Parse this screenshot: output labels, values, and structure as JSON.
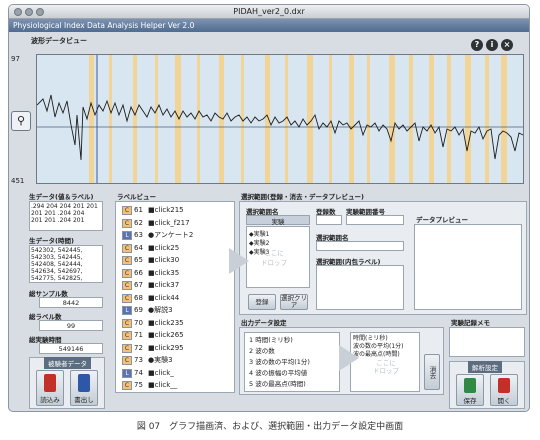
{
  "window": {
    "title": "PIDAH_ver2_0.dxr"
  },
  "app": {
    "title": "Physiological Index Data Analysis Helper Ver 2.0"
  },
  "wave_section": {
    "label": "波形データビュー",
    "y_top": "97",
    "y_bottom": "451"
  },
  "raw_data_label_section": {
    "label": "生データ(値＆ラベル)",
    "rows": [
      ".294 204 204 201 201",
      "201 201 .204 204",
      "201 201 .204 201"
    ]
  },
  "raw_data_time_section": {
    "label": "生データ(時間)",
    "rows": [
      "542302, 542445,",
      "542303, 542445,",
      "542408, 542444,",
      "542634, 542697,",
      "542775, 542825,"
    ]
  },
  "total_samples": {
    "label": "総サンプル数",
    "value": "8442"
  },
  "total_labels": {
    "label": "総ラベル数",
    "value": "99"
  },
  "total_time": {
    "label": "総実験時間",
    "value": "549146"
  },
  "measurement_data": {
    "label": "被験者データ",
    "load_label": "読込み",
    "save_label": "書出し"
  },
  "label_view": {
    "label": "ラベルビュー",
    "items": [
      {
        "badge": "C",
        "number": "61",
        "name": "■click215",
        "color": "#f4c078"
      },
      {
        "badge": "C",
        "number": "62",
        "name": "■click_f217",
        "color": "#f4c078"
      },
      {
        "badge": "L",
        "number": "63",
        "name": "●アンケート2",
        "color": "#5b73b0"
      },
      {
        "badge": "C",
        "number": "64",
        "name": "■click25",
        "color": "#f4c078"
      },
      {
        "badge": "C",
        "number": "65",
        "name": "■click30",
        "color": "#f4c078"
      },
      {
        "badge": "C",
        "number": "66",
        "name": "■click35",
        "color": "#f4c078"
      },
      {
        "badge": "C",
        "number": "67",
        "name": "■click37",
        "color": "#f4c078"
      },
      {
        "badge": "C",
        "number": "68",
        "name": "■click44",
        "color": "#f4c078"
      },
      {
        "badge": "L",
        "number": "69",
        "name": "●解説3",
        "color": "#5b73b0"
      },
      {
        "badge": "C",
        "number": "70",
        "name": "■click235",
        "color": "#f4c078"
      },
      {
        "badge": "C",
        "number": "71",
        "name": "■click265",
        "color": "#f4c078"
      },
      {
        "badge": "C",
        "number": "72",
        "name": "■click295",
        "color": "#f4c078"
      },
      {
        "badge": "C",
        "number": "73",
        "name": "●実験3",
        "color": "#f4c078"
      },
      {
        "badge": "L",
        "number": "74",
        "name": "■click_",
        "color": "#5b73b0"
      },
      {
        "badge": "C",
        "number": "75",
        "name": "■click__",
        "color": "#f4c078"
      }
    ]
  },
  "selection": {
    "label": "選択範囲(登録・消去・データプレビュー)",
    "range_name_label": "選択範囲名",
    "range_name_tab": "実験",
    "range_list": [
      "◆実験1",
      "◆実験2",
      "◆実験3"
    ],
    "drop_hint_1": "ここに",
    "drop_hint_2": "ドロップ",
    "register_count_label": "登録数",
    "range_number_label": "実験範囲番号",
    "preview_label": "データプレビュー",
    "range_label": "選択範囲名",
    "range_content_label": "選択範囲(内包ラベル)",
    "register_btn": "登録",
    "clear_btn": "選択クリア"
  },
  "output": {
    "label": "出力データ設定",
    "options": [
      "1 時間(ミリ秒)",
      "2 波の数",
      "3 波の数の平均(1分)",
      "4 波の振幅の平均値",
      "5 波の最高点(時間)"
    ],
    "selected": [
      "時間(ミリ秒)",
      "波の数の平均(1分)",
      "波の最高点(時間)"
    ],
    "drop_hint_1": "ここに",
    "drop_hint_2": "ドロップ",
    "side_btn": "消去"
  },
  "memo": {
    "label": "実験記録メモ"
  },
  "analysis": {
    "label": "解析設定",
    "save_label": "保存",
    "open_label": "開く"
  },
  "caption": "図 07　グラフ描画済、および、選択範囲・出力データ設定中画面"
}
